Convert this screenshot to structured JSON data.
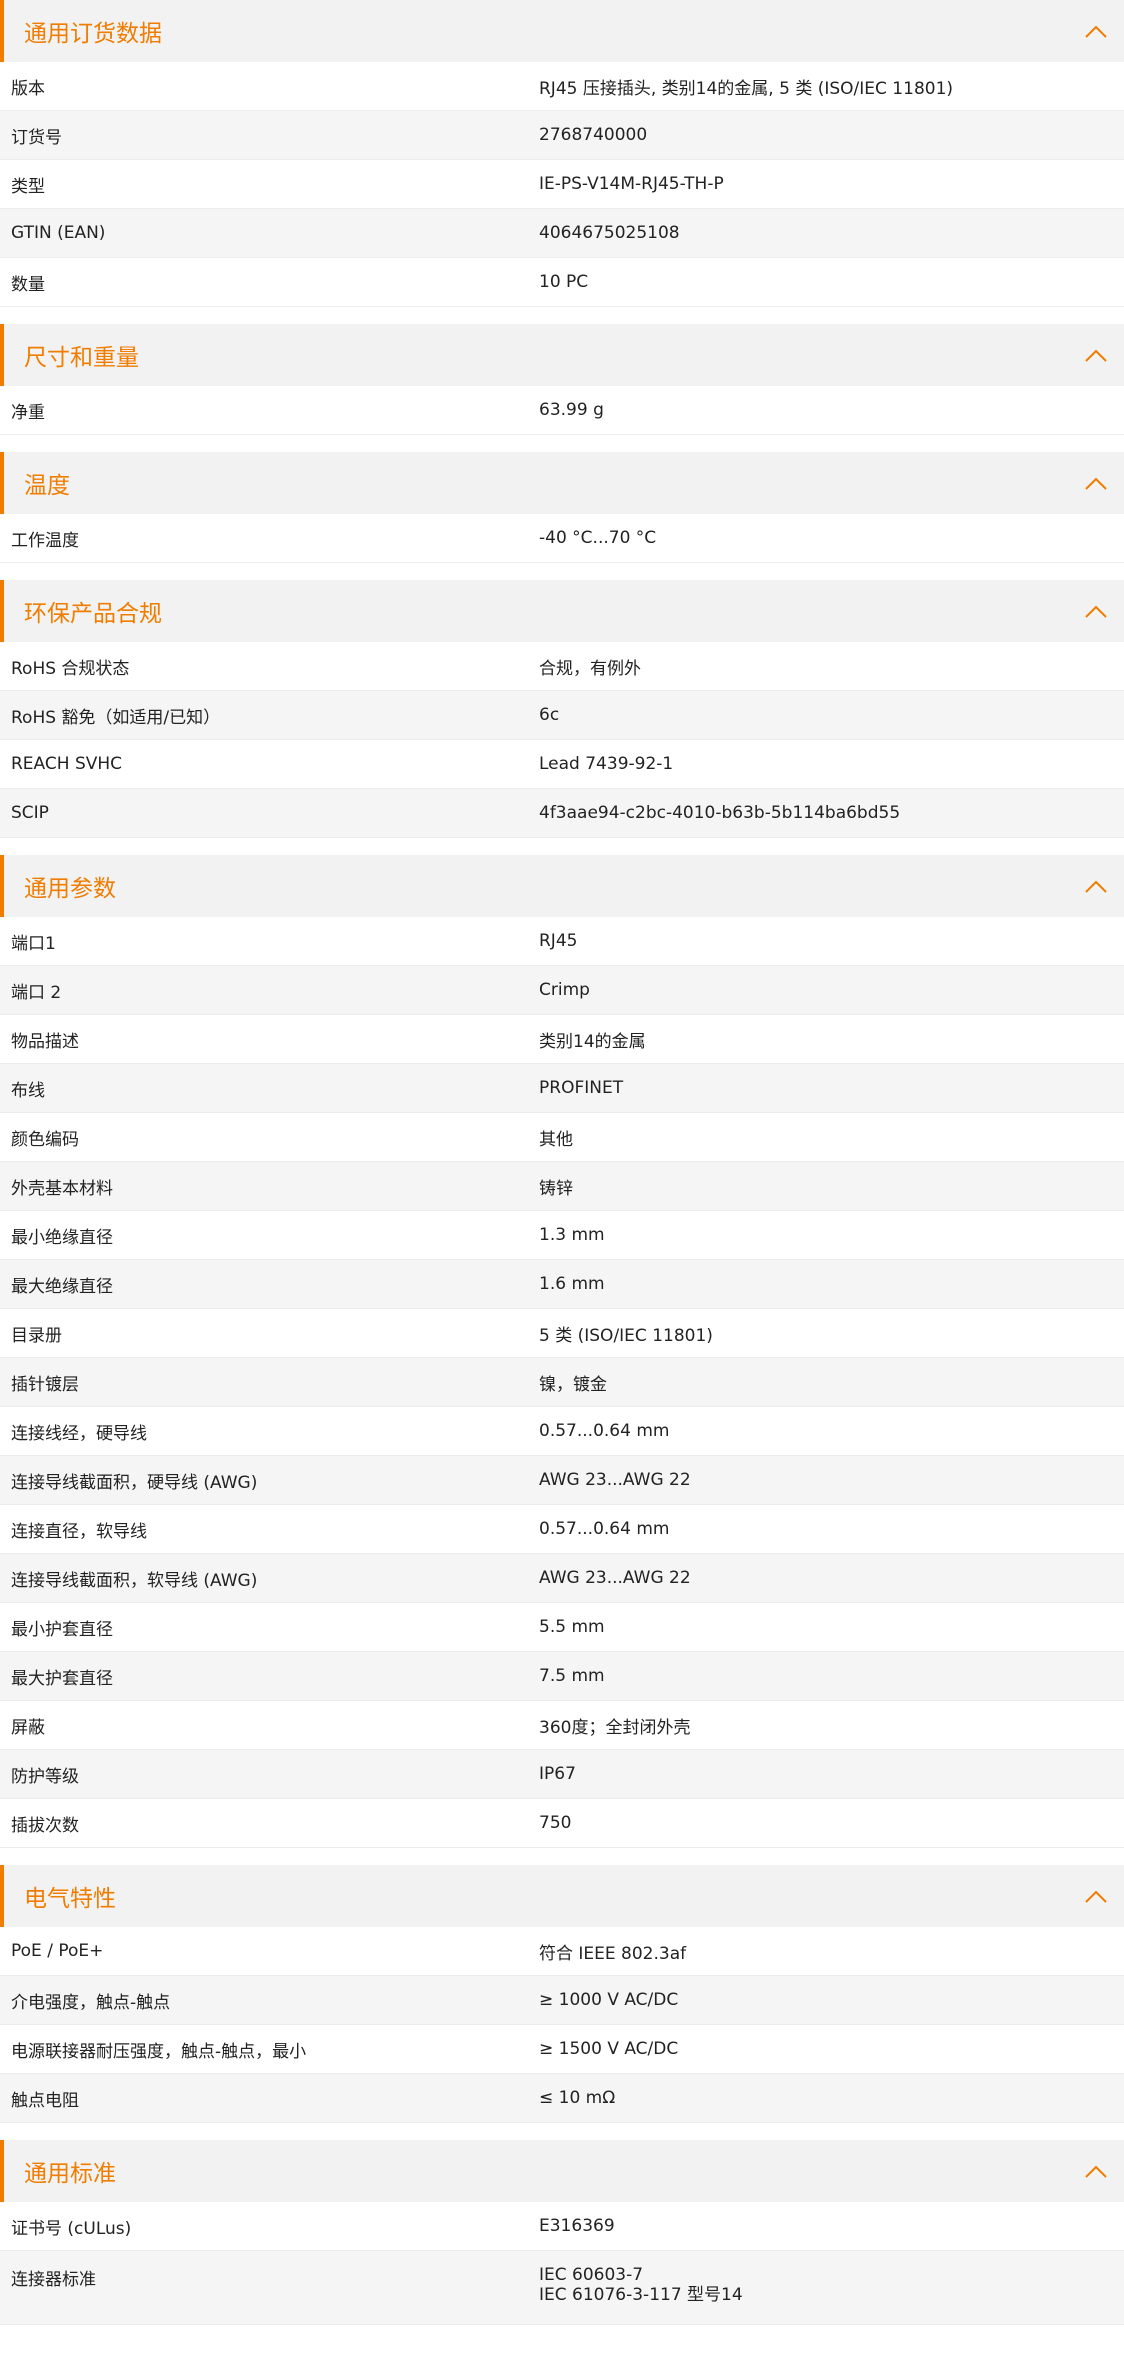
{
  "accent_color": "#f07d00",
  "collapse_icon": "chevron-up-icon",
  "sections": [
    {
      "title": "通用订货数据",
      "rows": [
        {
          "label": "版本",
          "value": "RJ45 压接插头, 类别14的金属, 5 类 (ISO/IEC 11801)"
        },
        {
          "label": "订货号",
          "value": "2768740000"
        },
        {
          "label": "类型",
          "value": "IE-PS-V14M-RJ45-TH-P"
        },
        {
          "label": "GTIN (EAN)",
          "value": "4064675025108"
        },
        {
          "label": "数量",
          "value": "10  PC"
        }
      ]
    },
    {
      "title": "尺寸和重量",
      "rows": [
        {
          "label": "净重",
          "value": "63.99  g"
        }
      ]
    },
    {
      "title": "温度",
      "rows": [
        {
          "label": "工作温度",
          "value": "-40 °C...70 °C"
        }
      ]
    },
    {
      "title": "环保产品合规",
      "rows": [
        {
          "label": "RoHS 合规状态",
          "value": "合规，有例外"
        },
        {
          "label": "RoHS 豁免（如适用/已知）",
          "value": "6c"
        },
        {
          "label": "REACH SVHC",
          "value": "Lead 7439-92-1"
        },
        {
          "label": "SCIP",
          "value": "4f3aae94-c2bc-4010-b63b-5b114ba6bd55"
        }
      ]
    },
    {
      "title": "通用参数",
      "rows": [
        {
          "label": "端口1",
          "value": "RJ45"
        },
        {
          "label": "端口 2",
          "value": "Crimp"
        },
        {
          "label": "物品描述",
          "value": "类别14的金属"
        },
        {
          "label": "布线",
          "value": "PROFINET"
        },
        {
          "label": "颜色编码",
          "value": "其他"
        },
        {
          "label": "外壳基本材料",
          "value": "铸锌"
        },
        {
          "label": "最小绝缘直径",
          "value": "1.3  mm"
        },
        {
          "label": "最大绝缘直径",
          "value": "1.6  mm"
        },
        {
          "label": "目录册",
          "value": "5 类 (ISO/IEC 11801)"
        },
        {
          "label": "插针镀层",
          "value": "镍，镀金"
        },
        {
          "label": "连接线经，硬导线",
          "value": "0.57...0.64 mm"
        },
        {
          "label": "连接导线截面积，硬导线 (AWG)",
          "value": "AWG 23...AWG 22"
        },
        {
          "label": "连接直径，软导线",
          "value": "0.57...0.64 mm"
        },
        {
          "label": "连接导线截面积，软导线 (AWG)",
          "value": "AWG 23...AWG 22"
        },
        {
          "label": "最小护套直径",
          "value": "5.5  mm"
        },
        {
          "label": "最大护套直径",
          "value": "7.5  mm"
        },
        {
          "label": "屏蔽",
          "value": "360度；全封闭外壳"
        },
        {
          "label": "防护等级",
          "value": "IP67"
        },
        {
          "label": "插拔次数",
          "value": "750"
        }
      ]
    },
    {
      "title": "电气特性",
      "rows": [
        {
          "label": "PoE / PoE+",
          "value": "符合 IEEE 802.3af"
        },
        {
          "label": "介电强度，触点-触点",
          "value": "≥ 1000 V AC/DC"
        },
        {
          "label": "电源联接器耐压强度，触点-触点，最小",
          "value": "≥ 1500 V AC/DC"
        },
        {
          "label": "触点电阻",
          "value": "≤ 10 mΩ"
        }
      ]
    },
    {
      "title": "通用标准",
      "rows": [
        {
          "label": "证书号 (cULus)",
          "value": "E316369"
        },
        {
          "label": "连接器标准",
          "value": "IEC 60603-7",
          "value2": "IEC 61076-3-117 型号14"
        }
      ]
    }
  ]
}
